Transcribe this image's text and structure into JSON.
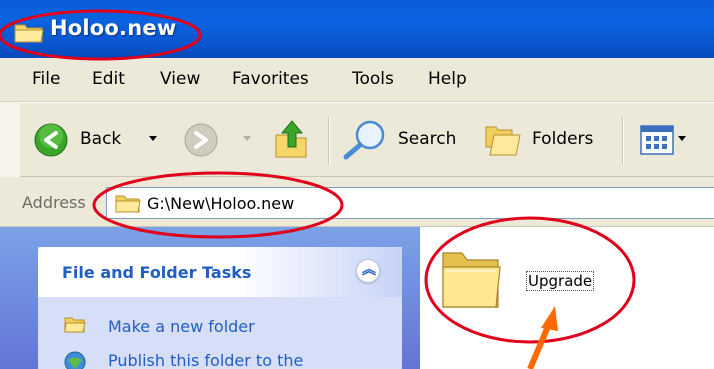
{
  "window": {
    "title": "Holoo.new"
  },
  "menu": {
    "items": [
      "File",
      "Edit",
      "View",
      "Favorites",
      "Tools",
      "Help"
    ]
  },
  "toolbar": {
    "back_label": "Back",
    "search_label": "Search",
    "folders_label": "Folders"
  },
  "address": {
    "label": "Address",
    "path": "G:\\New\\Holoo.new"
  },
  "task_pane": {
    "title": "File and Folder Tasks",
    "collapse_glyph": "«",
    "links": [
      "Make a new folder",
      "Publish this folder to the"
    ]
  },
  "content": {
    "items": [
      {
        "name": "Upgrade",
        "icon": "folder-icon"
      }
    ]
  },
  "colors": {
    "titlebar": "#0a5fd8",
    "chrome": "#ece9d8",
    "task_link": "#215dc6",
    "annotation_circle": "#e0001b",
    "annotation_arrow": "#ff6a00"
  }
}
